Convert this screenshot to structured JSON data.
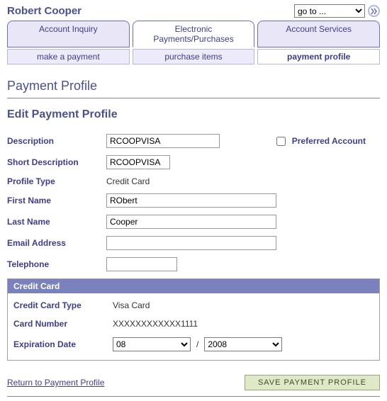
{
  "header": {
    "user_name": "Robert Cooper",
    "goto_label": "go to ..."
  },
  "tabs": {
    "items": [
      {
        "label": "Account Inquiry"
      },
      {
        "label": "Electronic Payments/Purchases"
      },
      {
        "label": "Account Services"
      }
    ]
  },
  "subtabs": {
    "items": [
      {
        "label": "make a payment"
      },
      {
        "label": "purchase items"
      },
      {
        "label": "payment profile"
      }
    ]
  },
  "page": {
    "title": "Payment Profile",
    "section_title": "Edit Payment Profile"
  },
  "form": {
    "labels": {
      "description": "Description",
      "short_description": "Short Description",
      "profile_type": "Profile Type",
      "first_name": "First Name",
      "last_name": "Last Name",
      "email": "Email Address",
      "telephone": "Telephone",
      "preferred": "Preferred Account"
    },
    "values": {
      "description": "RCOOPVISA",
      "short_description": "RCOOPVISA",
      "profile_type": "Credit Card",
      "first_name": "RObert",
      "last_name": "Cooper",
      "email": "",
      "telephone": ""
    }
  },
  "credit_card": {
    "header": "Credit Card",
    "labels": {
      "type": "Credit Card Type",
      "number": "Card Number",
      "expiration": "Expiration Date"
    },
    "values": {
      "type": "Visa Card",
      "number": "XXXXXXXXXXXX1111",
      "exp_month": "08",
      "exp_year": "2008",
      "separator": "/"
    }
  },
  "footer": {
    "return_link": "Return to Payment Profile",
    "save_button": "SAVE PAYMENT PROFILE"
  }
}
